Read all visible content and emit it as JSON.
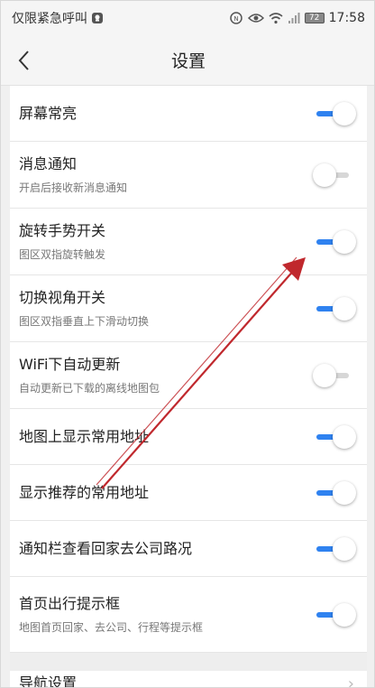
{
  "status_bar": {
    "left_text": "仅限紧急呼叫",
    "battery": "72",
    "time": "17:58"
  },
  "header": {
    "title": "设置"
  },
  "settings": [
    {
      "title": "屏幕常亮",
      "subtitle": "",
      "on": true
    },
    {
      "title": "消息通知",
      "subtitle": "开启后接收新消息通知",
      "on": false
    },
    {
      "title": "旋转手势开关",
      "subtitle": "图区双指旋转触发",
      "on": true
    },
    {
      "title": "切换视角开关",
      "subtitle": "图区双指垂直上下滑动切换",
      "on": true
    },
    {
      "title": "WiFi下自动更新",
      "subtitle": "自动更新已下载的离线地图包",
      "on": false
    },
    {
      "title": "地图上显示常用地址",
      "subtitle": "",
      "on": true
    },
    {
      "title": "显示推荐的常用地址",
      "subtitle": "",
      "on": true
    },
    {
      "title": "通知栏查看回家去公司路况",
      "subtitle": "",
      "on": true
    },
    {
      "title": "首页出行提示框",
      "subtitle": "地图首页回家、去公司、行程等提示框",
      "on": true
    }
  ],
  "nav_item": {
    "title": "导航设置"
  },
  "colors": {
    "toggle_on": "#2f82f0",
    "toggle_off": "#d7d7d7",
    "annotation_arrow": "#c0282d"
  },
  "icons": {
    "back": "chevron-left-icon",
    "status": [
      "notification-icon",
      "eye-icon",
      "wifi-icon",
      "signal-icon",
      "battery-icon"
    ]
  }
}
